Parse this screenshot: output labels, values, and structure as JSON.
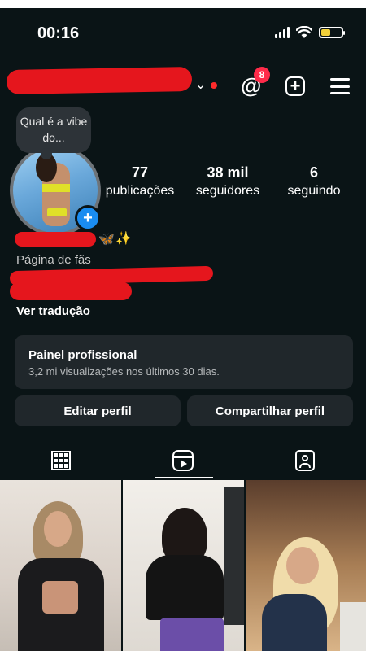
{
  "status_bar": {
    "time": "00:16",
    "battery_level": 0.45
  },
  "header": {
    "notification_count": "8"
  },
  "profile": {
    "note": "Qual é a vibe do...",
    "stats": [
      {
        "value": "77",
        "label": "publicações"
      },
      {
        "value": "38 mil",
        "label": "seguidores"
      },
      {
        "value": "6",
        "label": "seguindo"
      }
    ],
    "name_emojis": {
      "butterfly": "🦋",
      "sparkles": "✨"
    },
    "category": "Página de fãs",
    "translate_label": "Ver tradução"
  },
  "dashboard": {
    "title": "Painel profissional",
    "subtitle": "3,2 mi visualizações nos últimos 30 dias."
  },
  "actions": {
    "edit_label": "Editar perfil",
    "share_label": "Compartilhar perfil"
  },
  "tabs": {
    "active": "reels"
  },
  "colors": {
    "background": "#0a1416",
    "accent": "#1a8cf0",
    "badge": "#ff2b4a",
    "redaction": "#e5161d"
  }
}
